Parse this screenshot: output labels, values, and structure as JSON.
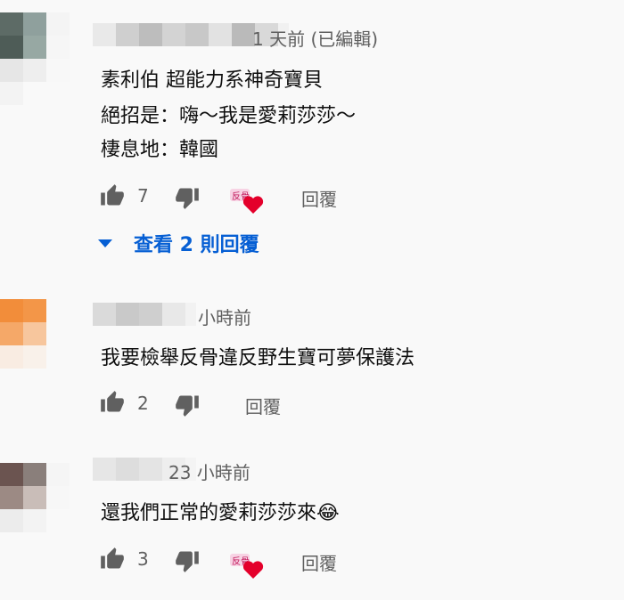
{
  "comments": [
    {
      "timestamp": "1 天前 (已編輯)",
      "lines": [
        "素利伯 超能力系神奇寶貝",
        "絕招是：嗨～我是愛莉莎莎～",
        "棲息地：韓國"
      ],
      "likes": "7",
      "reply_label": "回覆",
      "view_replies": "查看 2 則回覆"
    },
    {
      "timestamp": "小時前",
      "lines": [
        "我要檢舉反骨違反野生寶可夢保護法"
      ],
      "likes": "2",
      "reply_label": "回覆"
    },
    {
      "timestamp": "23 小時前",
      "lines": [
        "還我們正常的愛莉莎莎來😂"
      ],
      "likes": "3",
      "reply_label": "回覆"
    }
  ],
  "colors": {
    "link_blue": "#065fd4",
    "secondary_text": "#606060",
    "heart_red": "#e4002b"
  }
}
